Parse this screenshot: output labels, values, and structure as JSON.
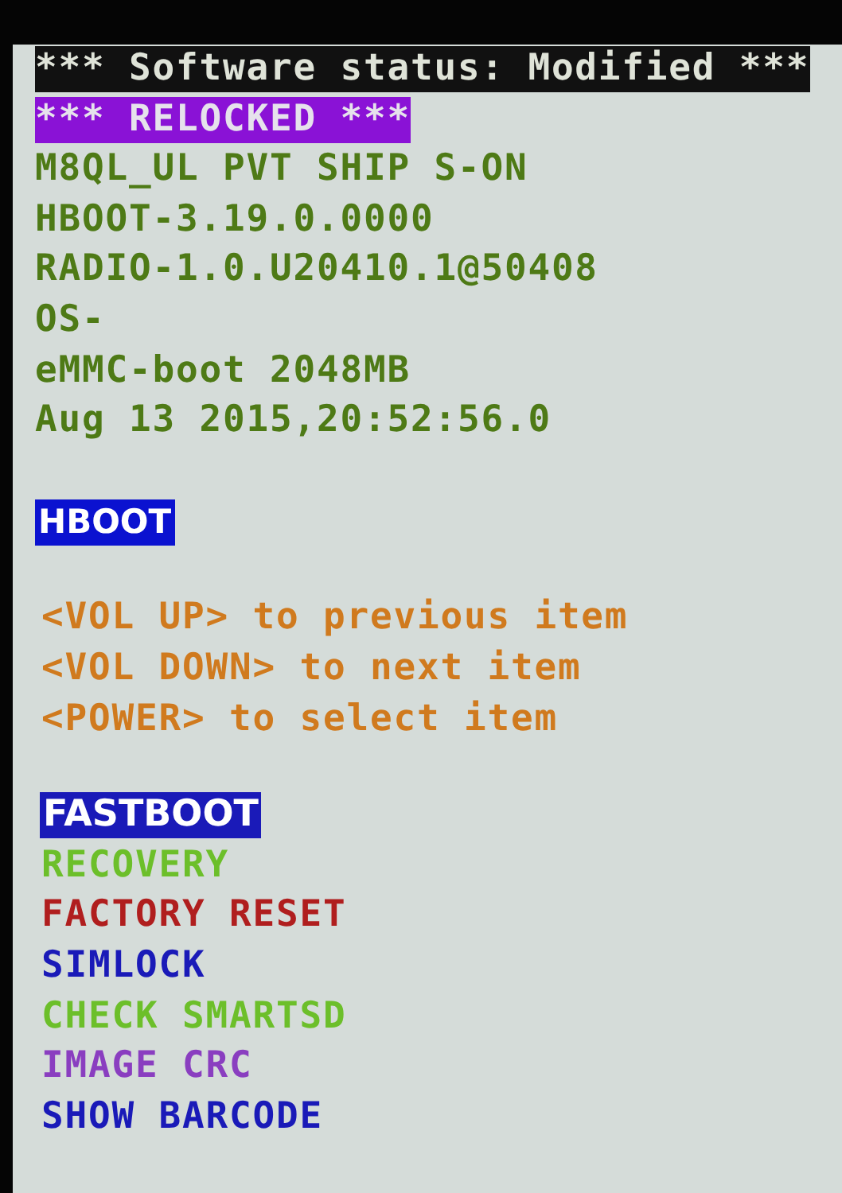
{
  "status_banner": "*** Software status: Modified ***",
  "lock_banner": "*** RELOCKED ***",
  "info_lines": [
    "M8QL_UL PVT SHIP S-ON",
    "HBOOT-3.19.0.0000",
    "RADIO-1.0.U20410.1@50408",
    "OS-",
    "eMMC-boot 2048MB",
    "Aug 13 2015,20:52:56.0"
  ],
  "section_title": "HBOOT",
  "instructions": [
    "<VOL UP> to previous item",
    "<VOL DOWN> to next item",
    "<POWER> to select item"
  ],
  "menu": [
    {
      "label": "FASTBOOT",
      "color": "#1a1ab8",
      "selected": true
    },
    {
      "label": "RECOVERY",
      "color": "#6cbf2a",
      "selected": false
    },
    {
      "label": "FACTORY RESET",
      "color": "#b01e1e",
      "selected": false
    },
    {
      "label": "SIMLOCK",
      "color": "#1a1ab8",
      "selected": false
    },
    {
      "label": "CHECK SMARTSD",
      "color": "#6cbf2a",
      "selected": false
    },
    {
      "label": "IMAGE CRC",
      "color": "#8a3ec0",
      "selected": false
    },
    {
      "label": "SHOW BARCODE",
      "color": "#1a1ab8",
      "selected": false
    }
  ]
}
